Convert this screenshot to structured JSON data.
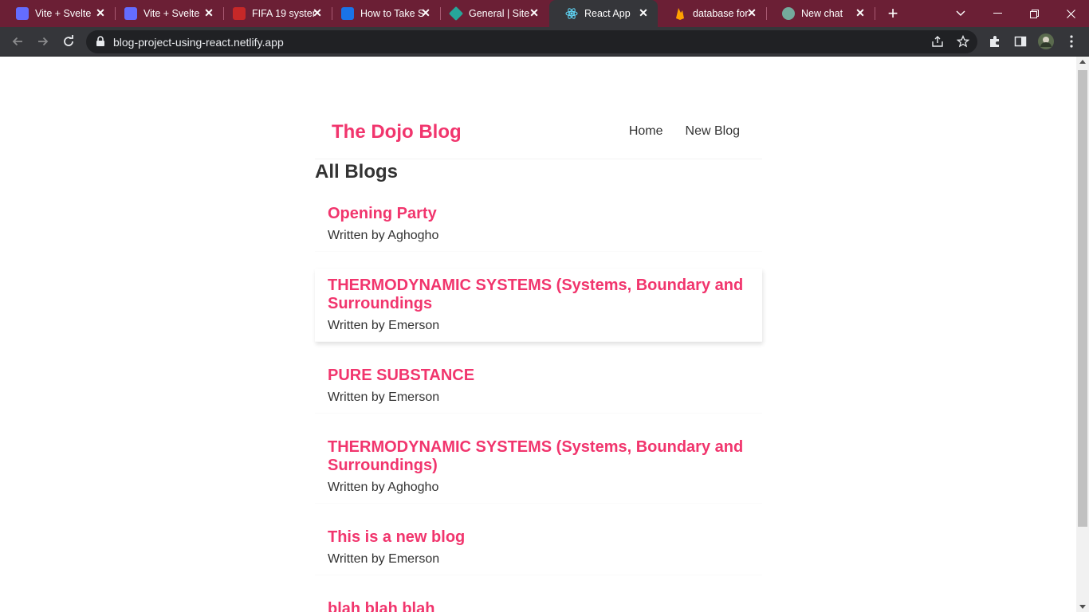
{
  "browser": {
    "tabs": [
      {
        "title": "Vite + Svelte",
        "active": false,
        "favicon_color": "#646cff"
      },
      {
        "title": "Vite + Svelte",
        "active": false,
        "favicon_color": "#646cff"
      },
      {
        "title": "FIFA 19 system",
        "active": false,
        "favicon_color": "#c62828"
      },
      {
        "title": "How to Take S",
        "active": false,
        "favicon_color": "#1a73e8"
      },
      {
        "title": "General | Site",
        "active": false,
        "favicon_color": "#26a69a"
      },
      {
        "title": "React App",
        "active": true,
        "favicon_color": "#61dafb"
      },
      {
        "title": "database for",
        "active": false,
        "favicon_color": "#ffa000"
      },
      {
        "title": "New chat",
        "active": false,
        "favicon_color": "#74aa9c"
      }
    ],
    "url": "blog-project-using-react.netlify.app"
  },
  "page": {
    "brand": "The Dojo Blog",
    "nav": {
      "home": "Home",
      "new_blog": "New Blog"
    },
    "heading": "All Blogs",
    "blogs": [
      {
        "title": "Opening Party",
        "author": "Written by Aghogho"
      },
      {
        "title": "THERMODYNAMIC SYSTEMS (Systems, Boundary and Surroundings",
        "author": "Written by Emerson"
      },
      {
        "title": "PURE SUBSTANCE",
        "author": "Written by Emerson"
      },
      {
        "title": "THERMODYNAMIC SYSTEMS (Systems, Boundary and Surroundings)",
        "author": "Written by Aghogho"
      },
      {
        "title": "This is a new blog",
        "author": "Written by Emerson"
      },
      {
        "title": "blah blah blah",
        "author": ""
      }
    ]
  },
  "colors": {
    "accent": "#f1356d",
    "text": "#333333",
    "tabbar": "#6b1f35",
    "toolbar": "#35363a"
  }
}
